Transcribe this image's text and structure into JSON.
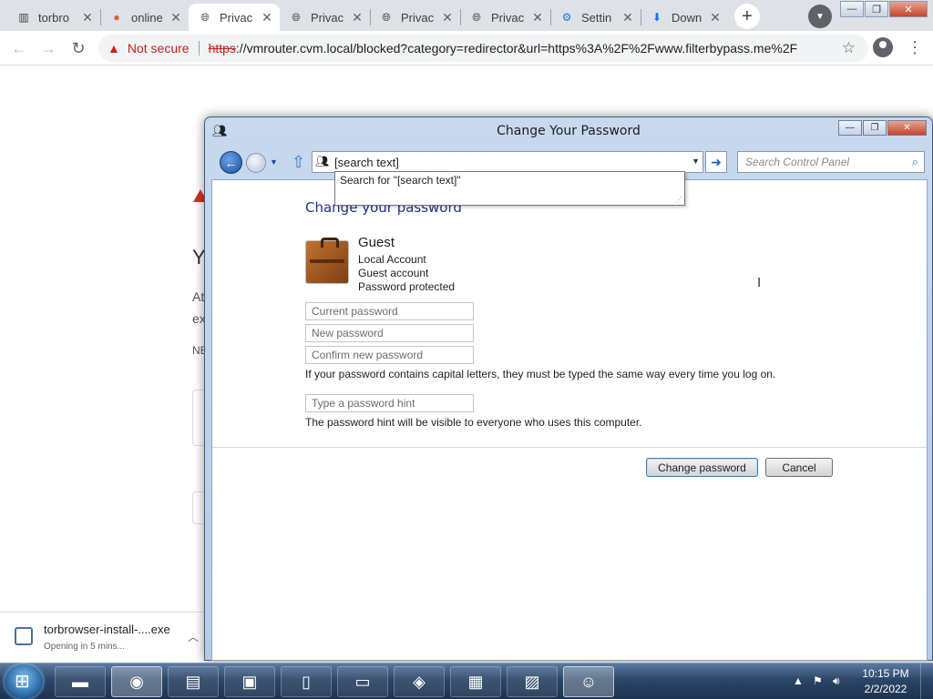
{
  "browser": {
    "tabs": [
      {
        "title": "torbro",
        "icon": "columns-icon"
      },
      {
        "title": "online",
        "icon": "duckduckgo-icon"
      },
      {
        "title": "Privac",
        "icon": "globe-icon"
      },
      {
        "title": "Privac",
        "icon": "globe-icon"
      },
      {
        "title": "Privac",
        "icon": "globe-icon"
      },
      {
        "title": "Privac",
        "icon": "globe-icon"
      },
      {
        "title": "Settin",
        "icon": "gear-icon"
      },
      {
        "title": "Down",
        "icon": "download-icon"
      }
    ],
    "new_tab_label": "+",
    "security_label": "Not secure",
    "url_scheme": "https",
    "url_rest": "://vmrouter.cvm.local/blocked?category=redirector&url=https%3A%2F%2Fwww.filterbypass.me%2F"
  },
  "background_page": {
    "heading_letter": "Y",
    "line1": "At",
    "line2": "ex",
    "line3": "NE"
  },
  "download": {
    "filename": "torbrowser-install-....exe",
    "status": "Opening in 5 mins..."
  },
  "dialog": {
    "title": "Change Your Password",
    "address_value": "[search text]",
    "search_placeholder": "Search Control Panel",
    "autocomplete_text": "Search for \"[search text]\"",
    "page_title": "Change your password",
    "account": {
      "name": "Guest",
      "lines": [
        "Local Account",
        "Guest account",
        "Password protected"
      ]
    },
    "fields": {
      "current_placeholder": "Current password",
      "new_placeholder": "New password",
      "confirm_placeholder": "Confirm new password",
      "hint_placeholder": "Type a password hint"
    },
    "capital_note": "If your password contains capital letters, they must be typed the same way every time you log on.",
    "hint_note": "The password hint will be visible to everyone who uses this computer.",
    "buttons": {
      "change": "Change password",
      "cancel": "Cancel"
    }
  },
  "taskbar": {
    "time": "10:15 PM",
    "date": "2/2/2022"
  },
  "colors": {
    "accent": "#1e3287",
    "warning": "#c5221f"
  }
}
